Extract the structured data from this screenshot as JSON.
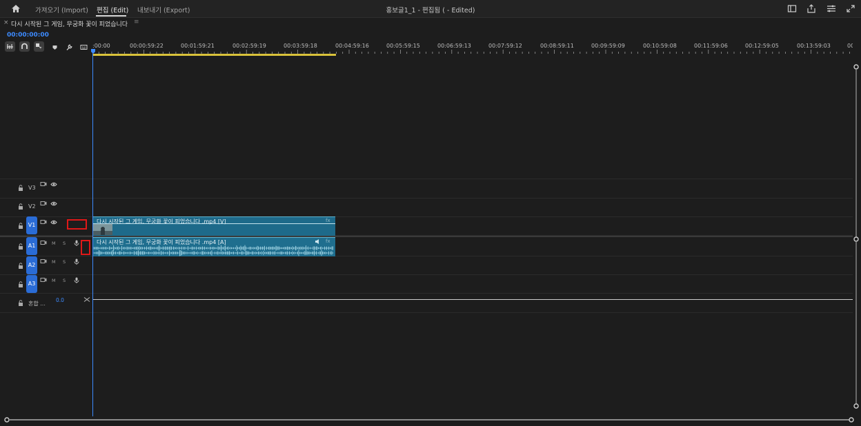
{
  "app": {
    "tabs": [
      {
        "label": "가져오기 (Import)",
        "active": false
      },
      {
        "label": "편집 (Edit)",
        "active": true
      },
      {
        "label": "내보내기 (Export)",
        "active": false
      }
    ],
    "project_title": "홍보글1_1 - 편집됨 ( - Edited)",
    "right_icons": [
      "panel-layout-icon",
      "share-icon",
      "menu-lines-icon",
      "expand-icon"
    ]
  },
  "sequence": {
    "close_glyph": "×",
    "name": "다시 시작된 그 게임, 무궁화 꽃이 피었습니다",
    "menu_glyph": "≡",
    "timecode": "00:00:00:00"
  },
  "tools": [
    "nest-icon",
    "snap-icon",
    "linked-selection-icon",
    "marker-icon",
    "wrench-icon",
    "caption-icon"
  ],
  "ruler": {
    "labels": [
      ":00:00",
      "00:00:59:22",
      "00:01:59:21",
      "00:02:59:19",
      "00:03:59:18",
      "00:04:59:16",
      "00:05:59:15",
      "00:06:59:13",
      "00:07:59:12",
      "00:08:59:11",
      "00:09:59:09",
      "00:10:59:08",
      "00:11:59:06",
      "00:12:59:05",
      "00:13:59:03",
      "00:"
    ]
  },
  "tracks": {
    "video": [
      {
        "name": "V3",
        "active": false
      },
      {
        "name": "V2",
        "active": false
      },
      {
        "name": "V1",
        "active": true
      }
    ],
    "audio": [
      {
        "name": "A1",
        "mute": "M",
        "solo": "S"
      },
      {
        "name": "A2",
        "mute": "M",
        "solo": "S"
      },
      {
        "name": "A3",
        "mute": "M",
        "solo": "S"
      }
    ],
    "mix": {
      "name": "혼합 ...",
      "value": "0.0"
    }
  },
  "clips": {
    "video": {
      "label": "다시 시작된 그 게임, 무궁화 꽃이 피었습니다 .mp4 [V]",
      "fx": "fx"
    },
    "audio": {
      "label": "다시 시작된 그 게임, 무궁화 꽃이 피었습니다 .mp4 [A]",
      "fx": "fx"
    }
  },
  "colors": {
    "accent": "#3d8bff",
    "track_active": "#2a6cd6",
    "clip": "#1e6a8a",
    "work_area": "#d9c23a",
    "highlight": "#e01818"
  }
}
